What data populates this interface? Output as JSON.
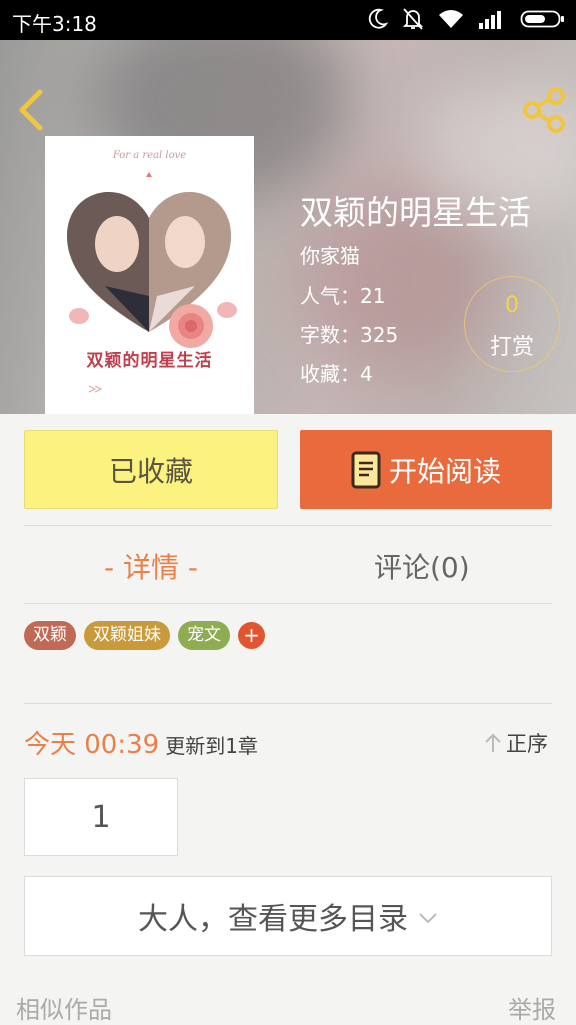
{
  "status_bar": {
    "time": "下午3:18"
  },
  "book": {
    "title": "双颖的明星生活",
    "author": "你家猫",
    "popularity": "人气：21",
    "word_count": "字数：325",
    "favorites": "收藏：4",
    "reward_count": "0",
    "reward_label": "打赏",
    "cover_tagline": "For a real love",
    "cover_title": "双颖的明星生活"
  },
  "actions": {
    "favorited_label": "已收藏",
    "read_label": "开始阅读"
  },
  "tabs": {
    "detail": "- 详情 -",
    "comments": "评论(0)"
  },
  "tags": [
    {
      "label": "双颖",
      "color": "#c06a56"
    },
    {
      "label": "双颖姐妹",
      "color": "#c99a3c"
    },
    {
      "label": "宠文",
      "color": "#8fac52"
    }
  ],
  "tag_add_label": "+",
  "update": {
    "date": "今天 00:39",
    "text": "更新到1章",
    "sort_label": "正序"
  },
  "chapter": {
    "number": "1"
  },
  "more_directory_label": "大人，查看更多目录",
  "footer": {
    "similar": "相似作品",
    "report": "举报"
  },
  "colors": {
    "accent": "#e96a3c",
    "favorited_bg": "#fcf27f",
    "active_tab": "#e9804a"
  },
  "icons": [
    "back-chevron-icon",
    "share-icon",
    "book-icon",
    "sort-up-arrow-icon",
    "chevron-down-icon",
    "moon-icon",
    "bell-off-icon",
    "wifi-icon",
    "signal-icon",
    "battery-icon"
  ]
}
